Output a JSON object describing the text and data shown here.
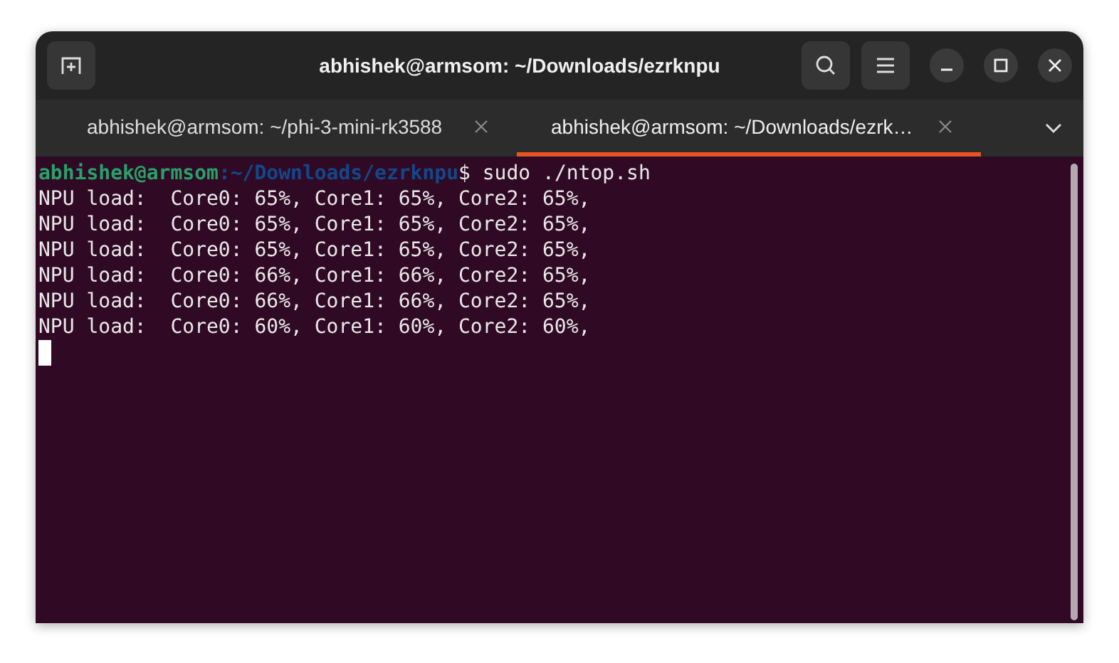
{
  "window": {
    "title": "abhishek@armsom: ~/Downloads/ezrknpu"
  },
  "tabs": [
    {
      "label": "abhishek@armsom: ~/phi-3-mini-rk3588",
      "selected": false
    },
    {
      "label": "abhishek@armsom: ~/Downloads/ezrk…",
      "selected": true
    }
  ],
  "terminal": {
    "prompt_user": "abhishek@armsom",
    "prompt_path": ":~/Downloads/ezrknpu",
    "command": "$ sudo ./ntop.sh",
    "output": [
      "NPU load:  Core0: 65%, Core1: 65%, Core2: 65%,",
      "NPU load:  Core0: 65%, Core1: 65%, Core2: 65%,",
      "NPU load:  Core0: 65%, Core1: 65%, Core2: 65%,",
      "NPU load:  Core0: 66%, Core1: 66%, Core2: 65%,",
      "NPU load:  Core0: 66%, Core1: 66%, Core2: 65%,",
      "NPU load:  Core0: 60%, Core1: 60%, Core2: 60%,"
    ]
  }
}
